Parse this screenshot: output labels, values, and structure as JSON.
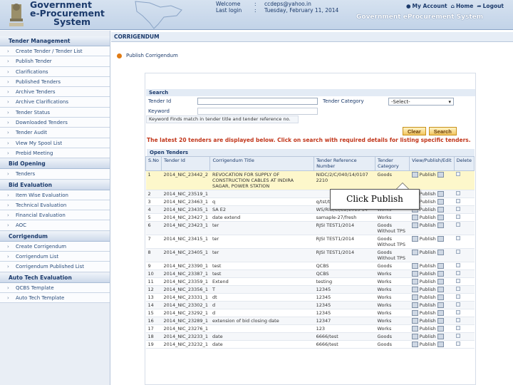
{
  "header": {
    "logo_line1": "Government",
    "logo_line2": "e-Procurement",
    "logo_line3": "System",
    "welcome_label": "Welcome",
    "welcome_value": "ccdeps@yahoo.in",
    "last_login_label": "Last login",
    "last_login_value": "Tuesday, February 11, 2014",
    "colon": ":",
    "my_account": "My Account",
    "home": "Home",
    "logout": "Logout",
    "system_title": "Government eProcurement System"
  },
  "sidebar": {
    "sections": [
      {
        "title": "Tender Management",
        "items": [
          "Create Tender / Tender List",
          "Publish Tender",
          "Clarifications",
          "Published Tenders",
          "Archive Tenders",
          "Archive Clarifications",
          "Tender Status",
          "Downloaded Tenders",
          "Tender Audit",
          "View My Spool List",
          "Prebid Meeting"
        ]
      },
      {
        "title": "Bid Opening",
        "items": [
          "Tenders"
        ]
      },
      {
        "title": "Bid Evaluation",
        "items": [
          "Item Wise Evaluation",
          "Technical Evaluation",
          "Financial Evaluation",
          "AOC"
        ]
      },
      {
        "title": "Corrigendum",
        "items": [
          "Create Corrigendum",
          "Corrigendum List",
          "Corrigendum Published List"
        ]
      },
      {
        "title": "Auto Tech Evaluation",
        "items": [
          "QCBS Template",
          "Auto Tech Template"
        ]
      }
    ]
  },
  "main": {
    "breadcrumb": "CORRIGENDUM",
    "section_title": "Publish Corrigendum",
    "search": {
      "title": "Search",
      "tender_id_label": "Tender Id",
      "tender_category_label": "Tender Category",
      "tender_category_value": "-Select-",
      "keyword_label": "Keyword",
      "keyword_hint": "Keyword Finds match in tender title and tender reference no.",
      "clear_label": "Clear",
      "search_label": "Search"
    },
    "notice": "The latest 20 tenders are displayed below. Click on search with required details for listing specific tenders.",
    "open_tenders_title": "Open Tenders",
    "table": {
      "headers": [
        "S.No",
        "Tender Id",
        "Corrigendum Title",
        "Tender Reference Number",
        "Tender Category",
        "View/Publish/Edit",
        "Delete"
      ],
      "publish_label": "Publish",
      "rows": [
        {
          "sno": "1",
          "tid": "2014_NIC_23442_2",
          "title": "REVOCATION FOR SUPPLY OF CONSTRUCTION CABLES AT INDIRA SAGAR, POWER STATION",
          "ref": "NIDC/2/C/040/14/0107 2210",
          "cat": "Goods"
        },
        {
          "sno": "2",
          "tid": "2014_NIC_23519_1",
          "title": "",
          "ref": "",
          "cat": "Goods"
        },
        {
          "sno": "3",
          "tid": "2014_NIC_23463_1",
          "title": "q",
          "ref": "q/tst/test",
          "cat": "Goods"
        },
        {
          "sno": "4",
          "tid": "2014_NIC_23435_1",
          "title": "SA E2",
          "ref": "WS/RID/CI/E2/2013 14",
          "cat": "Works"
        },
        {
          "sno": "5",
          "tid": "2014_NIC_23427_1",
          "title": "date extend",
          "ref": "samaple-27/fresh",
          "cat": "Works"
        },
        {
          "sno": "6",
          "tid": "2014_NIC_23423_1",
          "title": "ter",
          "ref": "RJSI TEST1/2014",
          "cat": "Goods Without TPS"
        },
        {
          "sno": "7",
          "tid": "2014_NIC_23415_1",
          "title": "ter",
          "ref": "RJSI TEST1/2014",
          "cat": "Goods Without TPS"
        },
        {
          "sno": "8",
          "tid": "2014_NIC_23405_1",
          "title": "ter",
          "ref": "RJSI TEST1/2014",
          "cat": "Goods Without TPS"
        },
        {
          "sno": "9",
          "tid": "2014_NIC_23390_1",
          "title": "test",
          "ref": "QCBS",
          "cat": "Goods"
        },
        {
          "sno": "10",
          "tid": "2014_NIC_23387_1",
          "title": "test",
          "ref": "QCBS",
          "cat": "Works"
        },
        {
          "sno": "11",
          "tid": "2014_NIC_23359_1",
          "title": "Extend",
          "ref": "testing",
          "cat": "Works"
        },
        {
          "sno": "12",
          "tid": "2014_NIC_23356_1",
          "title": "T",
          "ref": "12345",
          "cat": "Works"
        },
        {
          "sno": "13",
          "tid": "2014_NIC_23331_1",
          "title": "dt",
          "ref": "12345",
          "cat": "Works"
        },
        {
          "sno": "14",
          "tid": "2014_NIC_23302_1",
          "title": "d",
          "ref": "12345",
          "cat": "Works"
        },
        {
          "sno": "15",
          "tid": "2014_NIC_23292_1",
          "title": "d",
          "ref": "12345",
          "cat": "Works"
        },
        {
          "sno": "16",
          "tid": "2014_NIC_23289_1",
          "title": "extension of bid closing date",
          "ref": "12347",
          "cat": "Works"
        },
        {
          "sno": "17",
          "tid": "2014_NIC_23276_1",
          "title": "",
          "ref": "123",
          "cat": "Works"
        },
        {
          "sno": "18",
          "tid": "2014_NIC_23233_1",
          "title": "date",
          "ref": "6666/test",
          "cat": "Goods"
        },
        {
          "sno": "19",
          "tid": "2014_NIC_23232_1",
          "title": "date",
          "ref": "6666/test",
          "cat": "Goods"
        }
      ]
    }
  },
  "callout": {
    "text": "Click Publish"
  }
}
